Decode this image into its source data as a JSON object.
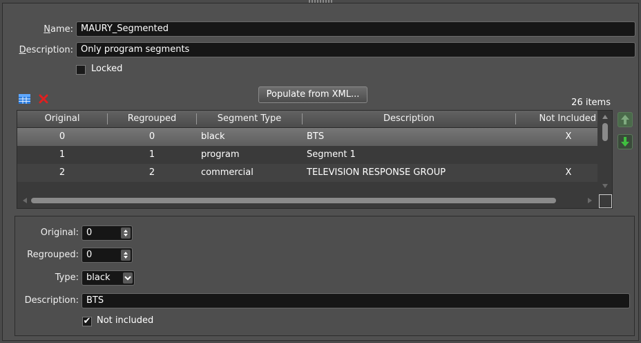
{
  "form": {
    "name_label_mnemonic": "N",
    "name_label_rest": "ame:",
    "name_value": "MAURY_Segmented",
    "description_label_mnemonic": "D",
    "description_label_rest": "escription:",
    "description_value": "Only program segments",
    "locked_label": "Locked"
  },
  "toolbar": {
    "grid_icon": "grid-icon",
    "delete_icon": "red-x-icon",
    "populate_label": "Populate from XML...",
    "item_count": "26 items"
  },
  "table": {
    "columns": [
      "Original",
      "Regrouped",
      "Segment Type",
      "Description",
      "Not Included"
    ],
    "rows": [
      {
        "original": "0",
        "regrouped": "0",
        "type": "black",
        "description": "BTS",
        "not_included": "X"
      },
      {
        "original": "1",
        "regrouped": "1",
        "type": "program",
        "description": "Segment 1",
        "not_included": ""
      },
      {
        "original": "2",
        "regrouped": "2",
        "type": "commercial",
        "description": "TELEVISION RESPONSE GROUP",
        "not_included": "X"
      }
    ]
  },
  "side_buttons": {
    "up_icon": "arrow-up-icon",
    "down_icon": "arrow-down-icon",
    "accent": "#3fbf3f"
  },
  "detail": {
    "original_label": "Original:",
    "original_value": "0",
    "regrouped_label": "Regrouped:",
    "regrouped_value": "0",
    "type_label": "Type:",
    "type_value": "black",
    "description_label": "Description:",
    "description_value": "BTS",
    "not_included_label": "Not included",
    "not_included_checked": true
  }
}
